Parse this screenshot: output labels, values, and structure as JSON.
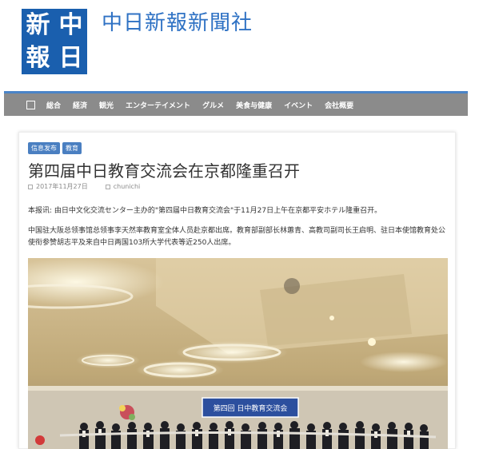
{
  "site": {
    "logo_chars": [
      "新",
      "中",
      "報",
      "日"
    ],
    "title": "中日新報新聞社"
  },
  "nav": {
    "items": [
      "総合",
      "経済",
      "観光",
      "エンターテイメント",
      "グルメ",
      "美食与健康",
      "イベント",
      "会社概要"
    ]
  },
  "article": {
    "tags": [
      "信息发布",
      "教育"
    ],
    "title": "第四届中日教育交流会在京都隆重召开",
    "date": "2017年11月27日",
    "author": "chunichi",
    "paragraph1": "本报讯: 由日中文化交流センター主办的\"第四届中日教育交流会\"于11月27日上午在京都平安ホテル隆重召开。",
    "paragraph2": "中国驻大阪总领事馆总领事李天然率教育室全体人员赴京都出席。教育部副部长林蕙青、高教司副司长王启明、驻日本使馆教育处公使衔参赞胡志平及来自中日两国103所大学代表等近250人出席。",
    "photo_banner": "第四回 日中教育交流会"
  },
  "colors": {
    "brand_blue": "#1a5fae",
    "title_blue": "#2f72c4",
    "nav_gray": "#8b8b8b",
    "tag_blue": "#4a7fc1"
  }
}
